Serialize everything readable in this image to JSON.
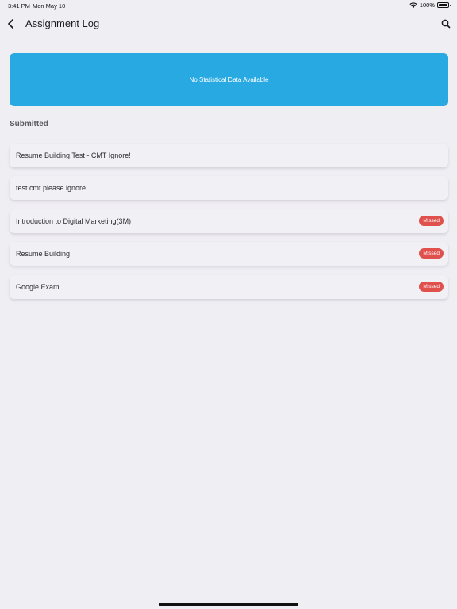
{
  "status_bar": {
    "time": "3:41 PM",
    "date": "Mon May 10",
    "battery": "100%",
    "icons": [
      "wifi-icon",
      "battery-icon"
    ]
  },
  "nav": {
    "title": "Assignment Log",
    "back_icon": "chevron-left-icon",
    "search_icon": "search-icon"
  },
  "stats": {
    "message": "No Statistical Data Available",
    "color": "#29a9e1"
  },
  "section": {
    "title": "Submitted"
  },
  "assignments": [
    {
      "title": "Resume Building Test - CMT Ignore!",
      "badge": ""
    },
    {
      "title": "test cmt please ignore",
      "badge": ""
    },
    {
      "title": "Introduction to Digital Marketing(3M)",
      "badge": "Missed"
    },
    {
      "title": "Resume Building",
      "badge": "Missed"
    },
    {
      "title": "Google Exam",
      "badge": "Missed"
    }
  ],
  "colors": {
    "background": "#efeef3",
    "missed_badge": "#e0504d"
  }
}
